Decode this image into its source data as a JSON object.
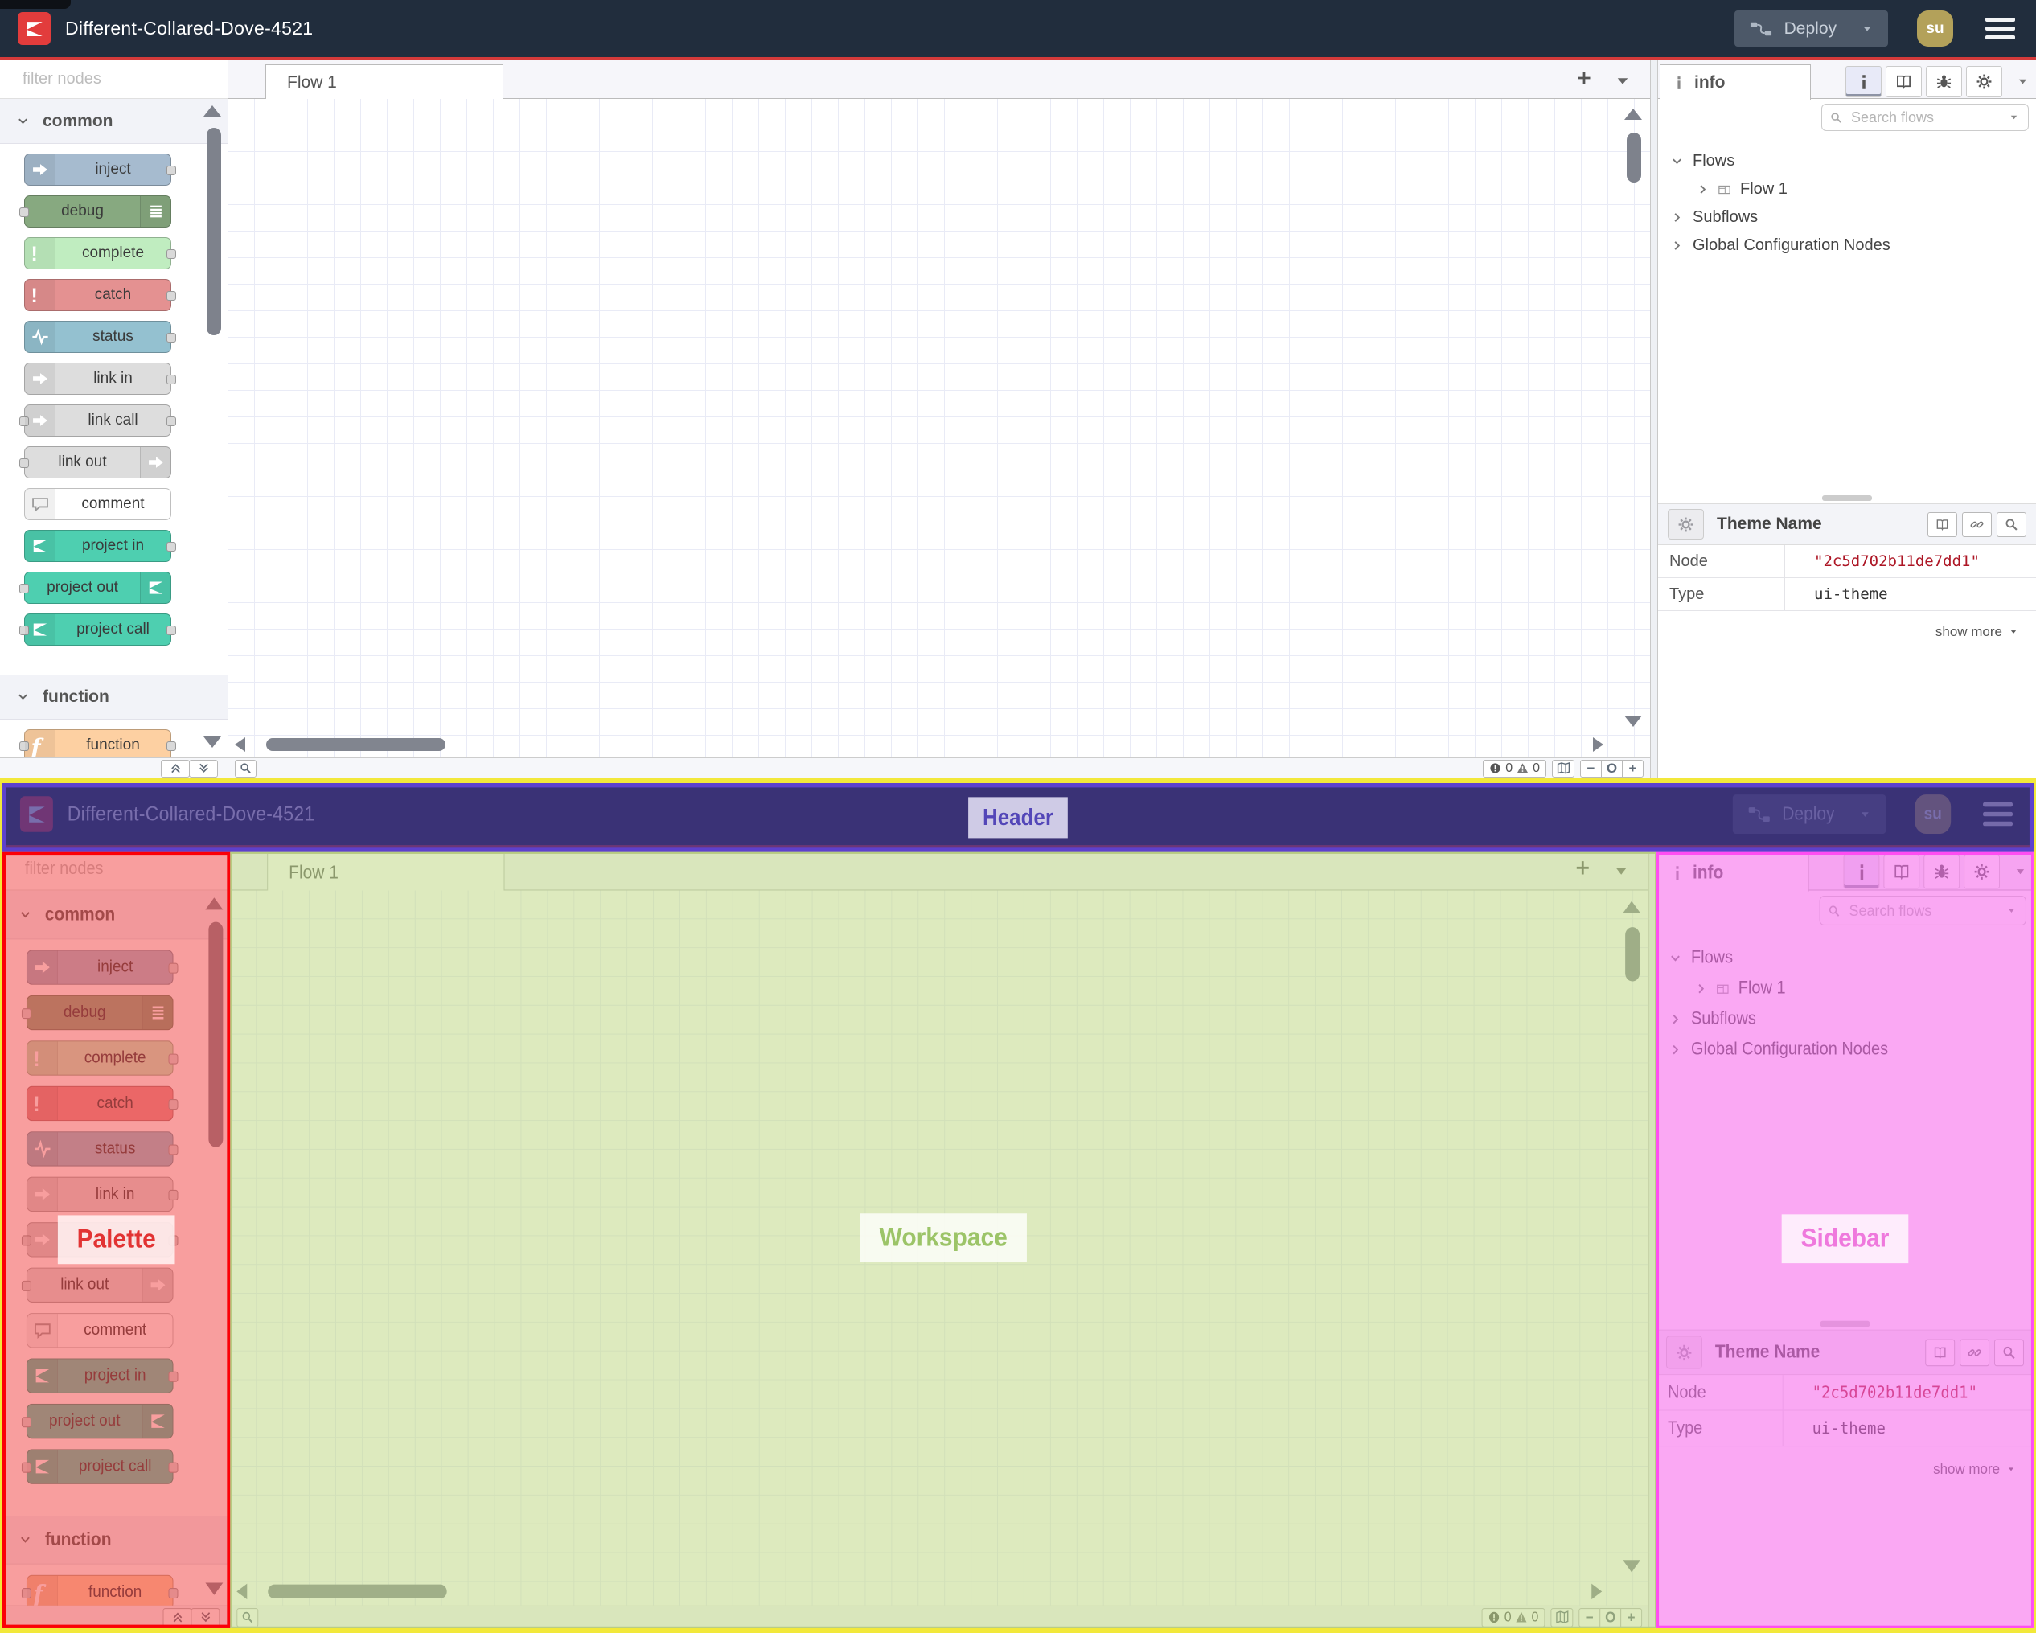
{
  "header": {
    "title": "Different-Collared-Dove-4521",
    "deploy_label": "Deploy",
    "avatar_text": "su"
  },
  "palette": {
    "filter_placeholder": "filter nodes",
    "items": [
      {
        "kind": "section",
        "label": "common"
      },
      {
        "kind": "node",
        "label": "inject",
        "color": "#a6bbcf",
        "icon": "arrow-right-icon",
        "icon_side": "left",
        "ports": "right"
      },
      {
        "kind": "node",
        "label": "debug",
        "color": "#87a980",
        "icon": "list-icon",
        "icon_side": "right",
        "ports": "left"
      },
      {
        "kind": "node",
        "label": "complete",
        "color": "#c0edc0",
        "icon": "exclamation-icon",
        "icon_side": "left",
        "ports": "right"
      },
      {
        "kind": "node",
        "label": "catch",
        "color": "#e49191",
        "icon": "exclamation-icon",
        "icon_side": "left",
        "ports": "right"
      },
      {
        "kind": "node",
        "label": "status",
        "color": "#94c1d0",
        "icon": "pulse-icon",
        "icon_side": "left",
        "ports": "right"
      },
      {
        "kind": "node",
        "label": "link in",
        "color": "#dddddd",
        "icon": "arrow-right-icon",
        "icon_side": "left",
        "ports": "right"
      },
      {
        "kind": "node",
        "label": "link call",
        "color": "#dddddd",
        "icon": "arrow-right-icon",
        "icon_side": "left",
        "ports": "both"
      },
      {
        "kind": "node",
        "label": "link out",
        "color": "#dddddd",
        "icon": "arrow-right-icon",
        "icon_side": "right",
        "ports": "left"
      },
      {
        "kind": "node",
        "label": "comment",
        "color": "#ffffff",
        "icon": "comment-icon",
        "icon_side": "left",
        "ports": "none",
        "icon_color": "#9a9a9a"
      },
      {
        "kind": "node",
        "label": "project in",
        "color": "#4ecfb0",
        "icon": "nodered-icon",
        "icon_side": "left",
        "ports": "right"
      },
      {
        "kind": "node",
        "label": "project out",
        "color": "#4ecfb0",
        "icon": "nodered-icon",
        "icon_side": "right",
        "ports": "left"
      },
      {
        "kind": "node",
        "label": "project call",
        "color": "#4ecfb0",
        "icon": "nodered-icon",
        "icon_side": "left",
        "ports": "both"
      },
      {
        "kind": "section",
        "label": "function"
      },
      {
        "kind": "node",
        "label": "function",
        "color": "#fdd0a2",
        "icon": "function-icon",
        "icon_side": "left",
        "ports": "both"
      }
    ]
  },
  "workspace": {
    "tab_label": "Flow 1",
    "footer": {
      "errors": "0",
      "warnings": "0",
      "zoom_out": "−",
      "zoom_reset": "O",
      "zoom_in": "+"
    }
  },
  "sidebar": {
    "tab_label": "info",
    "search_placeholder": "Search flows",
    "tree": [
      {
        "label": "Flows"
      },
      {
        "label": "Flow 1"
      },
      {
        "label": "Subflows"
      },
      {
        "label": "Global Configuration Nodes"
      }
    ],
    "panel": {
      "title": "Theme Name",
      "rows": [
        {
          "key": "Node",
          "value": "\"2c5d702b11de7dd1\""
        },
        {
          "key": "Type",
          "value": "ui-theme"
        }
      ],
      "show_more": "show more"
    }
  },
  "annotations": {
    "header": {
      "label": "Header",
      "color": "#5d41cc"
    },
    "palette": {
      "label": "Palette",
      "color": "#fb0007"
    },
    "workspace": {
      "label": "Workspace",
      "color": "#b7cc83"
    },
    "sidebar": {
      "label": "Sidebar",
      "color": "#ff4df2"
    },
    "frame_color": "#f2e83a"
  }
}
